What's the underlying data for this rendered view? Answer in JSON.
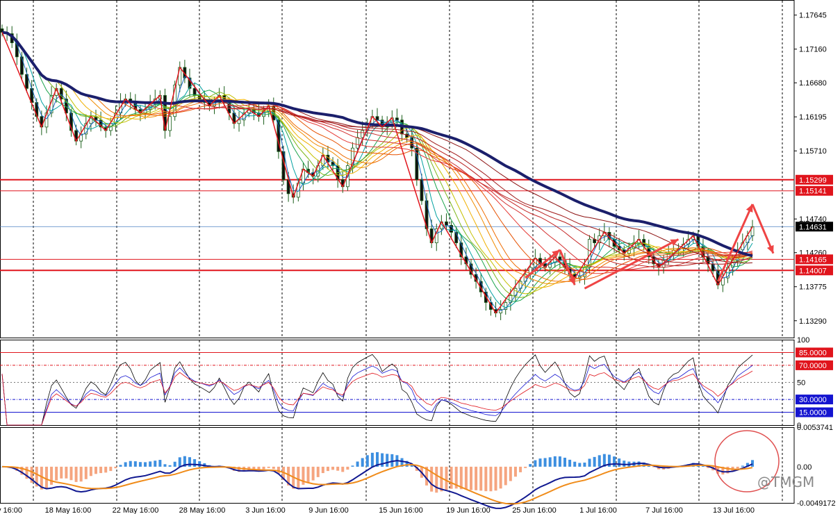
{
  "chart_data": {
    "type": "line",
    "description_free": true,
    "price_panel": {
      "yaxis_ticks": [
        "1.17645",
        "1.17160",
        "1.16680",
        "1.16195",
        "1.15710",
        "1.14740",
        "1.14260",
        "1.13775",
        "1.13290"
      ],
      "ylim": [
        1.1305,
        1.1786
      ],
      "xaxis_ticks": [
        "y 16:00",
        "18 May 16:00",
        "22 May 16:00",
        "28 May 16:00",
        "3 Jun 16:00",
        "9 Jun 16:00",
        "15 Jun 16:00",
        "19 Jun 16:00",
        "25 Jun 16:00",
        "1 Jul 16:00",
        "7 Jul 16:00",
        "13 Jul 16:00"
      ],
      "level_labels": [
        {
          "value": 1.15299,
          "label": "1.15299",
          "color": "#e0141c"
        },
        {
          "value": 1.15141,
          "label": "1.15141",
          "color": "#e0141c"
        },
        {
          "value": 1.14631,
          "label": "1.14631",
          "color": "#000000"
        },
        {
          "value": 1.14165,
          "label": "1.14165",
          "color": "#e0141c"
        },
        {
          "value": 1.14007,
          "label": "1.14007",
          "color": "#e0141c"
        }
      ],
      "close": [
        1.174,
        1.1738,
        1.1725,
        1.1705,
        1.168,
        1.166,
        1.164,
        1.162,
        1.1605,
        1.1625,
        1.165,
        1.166,
        1.1645,
        1.1625,
        1.16,
        1.1585,
        1.1595,
        1.161,
        1.162,
        1.1615,
        1.1605,
        1.16,
        1.161,
        1.1625,
        1.164,
        1.1645,
        1.164,
        1.163,
        1.1625,
        1.163,
        1.164,
        1.1645,
        1.165,
        1.16,
        1.162,
        1.1665,
        1.169,
        1.1675,
        1.166,
        1.165,
        1.1645,
        1.164,
        1.1635,
        1.164,
        1.165,
        1.164,
        1.1625,
        1.161,
        1.1615,
        1.1625,
        1.163,
        1.1625,
        1.162,
        1.1628,
        1.1635,
        1.1615,
        1.157,
        1.153,
        1.151,
        1.1505,
        1.1525,
        1.1545,
        1.154,
        1.1535,
        1.155,
        1.1565,
        1.1555,
        1.155,
        1.153,
        1.152,
        1.155,
        1.1575,
        1.159,
        1.16,
        1.161,
        1.162,
        1.1615,
        1.1605,
        1.1612,
        1.1618,
        1.1615,
        1.1595,
        1.159,
        1.1575,
        1.153,
        1.15,
        1.146,
        1.144,
        1.146,
        1.147,
        1.1465,
        1.1455,
        1.144,
        1.142,
        1.141,
        1.1395,
        1.1385,
        1.137,
        1.1355,
        1.1345,
        1.134,
        1.1345,
        1.1355,
        1.1365,
        1.1375,
        1.1385,
        1.1395,
        1.1405,
        1.1418,
        1.141,
        1.1405,
        1.1412,
        1.142,
        1.1415,
        1.1405,
        1.1395,
        1.139,
        1.1392,
        1.1405,
        1.1445,
        1.144,
        1.145,
        1.1455,
        1.1445,
        1.1435,
        1.143,
        1.1425,
        1.1432,
        1.144,
        1.1445,
        1.1435,
        1.142,
        1.141,
        1.1405,
        1.1415,
        1.1425,
        1.143,
        1.1432,
        1.1438,
        1.1445,
        1.145,
        1.1435,
        1.142,
        1.141,
        1.14,
        1.138,
        1.139,
        1.1405,
        1.1415,
        1.143,
        1.144,
        1.145,
        1.1463
      ],
      "mas": {
        "periods": [
          3,
          5,
          8,
          10,
          12,
          15,
          18,
          20,
          25,
          30,
          35,
          40,
          45,
          50,
          60
        ],
        "colors": [
          "#1565c0",
          "#00a0a0",
          "#1aa34a",
          "#7cb518",
          "#c5c000",
          "#f0b000",
          "#f08c00",
          "#ef6c00",
          "#e65100",
          "#e53935",
          "#d32f2f",
          "#c62828",
          "#b71c1c",
          "#a01818",
          "#8b1010"
        ],
        "thick_period": 70,
        "thick_color": "#1b1f6b"
      },
      "zigzag_color": "#e0141c",
      "arrow_color": "#ef4444"
    },
    "rsi_panel": {
      "yaxis_ticks": [
        "100",
        "50",
        "0"
      ],
      "levels": [
        {
          "value": 85,
          "label": "85.0000",
          "color": "#e0141c"
        },
        {
          "value": 70,
          "label": "70.0000",
          "color": "#e0141c"
        },
        {
          "value": 30,
          "label": "30.0000",
          "color": "#1414d0"
        },
        {
          "value": 15,
          "label": "15.0000",
          "color": "#1414d0"
        }
      ],
      "series_colors": [
        "#000000",
        "#1414d0",
        "#e0141c"
      ]
    },
    "macd_panel": {
      "yaxis_ticks": [
        "0.0053741",
        "0.00",
        "-0.0049172"
      ],
      "ylim": [
        -0.0049172,
        0.0053741
      ],
      "histogram_colors": {
        "positive": "#3d8fe0",
        "negative": "#f5a580"
      },
      "line_colors": {
        "macd": "#101890",
        "signal": "#f08c1a"
      },
      "highlight_circle_color": "#e05050"
    }
  },
  "watermark": "@TMGM"
}
